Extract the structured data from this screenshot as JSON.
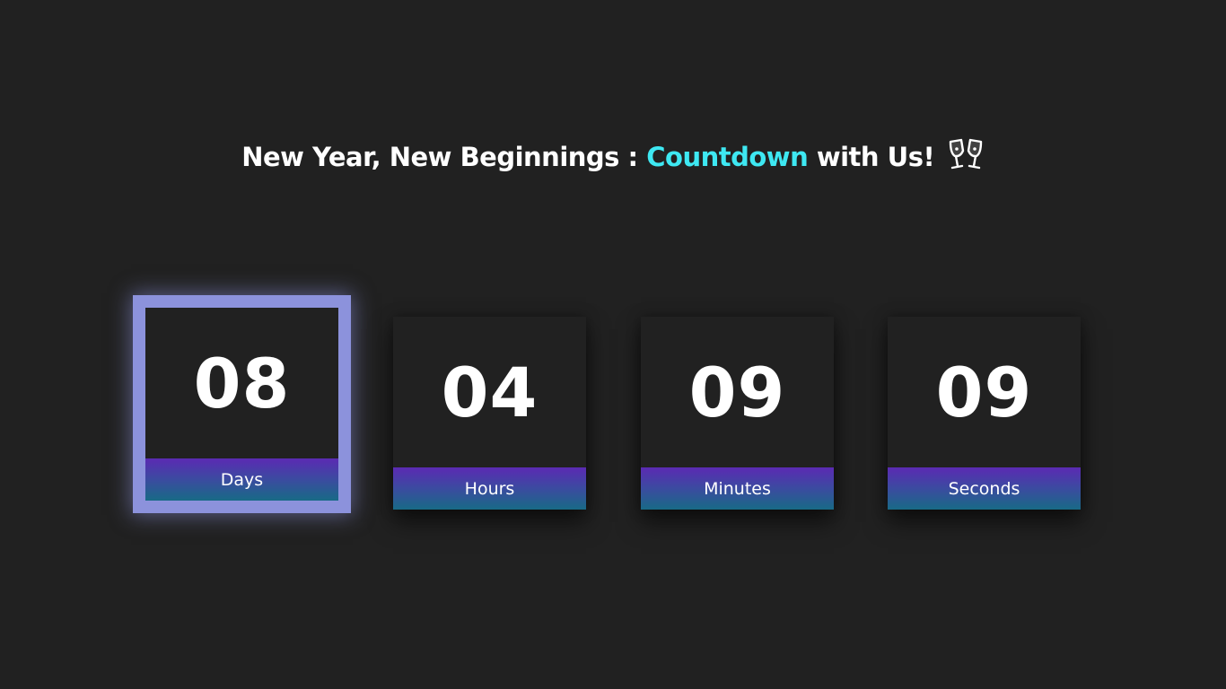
{
  "headline": {
    "part1": "New Year, New Beginnings : ",
    "accent": "Countdown",
    "part2": " with Us!",
    "icon": "clinking-glasses-icon"
  },
  "countdown": [
    {
      "value": "08",
      "label": "Days"
    },
    {
      "value": "04",
      "label": "Hours"
    },
    {
      "value": "09",
      "label": "Minutes"
    },
    {
      "value": "09",
      "label": "Seconds"
    }
  ],
  "colors": {
    "background": "#212121",
    "accent": "#3ee8f2",
    "card_glow": "#8c92dc",
    "label_gradient_top": "#5b2ab3",
    "label_gradient_bottom": "#186a86"
  }
}
